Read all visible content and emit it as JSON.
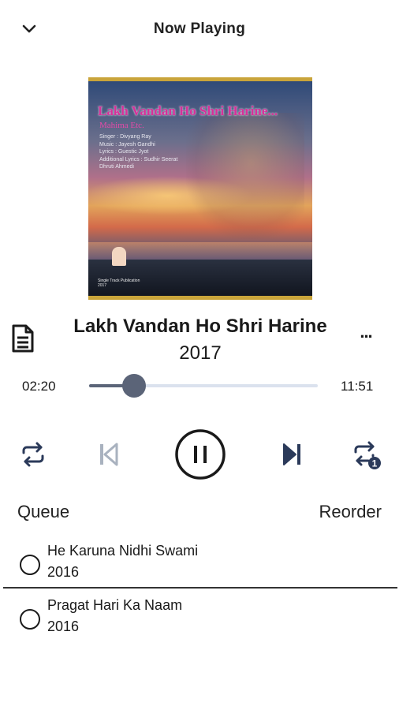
{
  "header": {
    "title": "Now Playing",
    "collapse_icon": "chevron-down-icon"
  },
  "artwork": {
    "title": "Lakh Vandan Ho Shri Harine...",
    "subtitle": "Mahima Etc.",
    "credits": [
      "Singer : Divyang Ray",
      "Music : Jayesh Gandhi",
      "Lyrics : Guestic Jyot",
      "Additional Lyrics : Sudhir Seerat",
      "Dhruti Ahmedi"
    ],
    "publisher": [
      "Single Track Publication",
      "2017"
    ],
    "frame_color": "#c9a43a"
  },
  "track": {
    "title": "Lakh Vandan Ho Shri Harine",
    "year": "2017",
    "more_label": "...",
    "lyrics_icon": "document-icon"
  },
  "progress": {
    "current": "02:20",
    "total": "11:51",
    "fraction": 0.197,
    "fill_color": "#5b6478",
    "track_color": "#dbe2ee"
  },
  "controls": {
    "repeat_icon": "repeat-icon",
    "previous_icon": "skip-previous-icon",
    "play_pause_icon": "pause-icon",
    "next_icon": "skip-next-icon",
    "repeat_one_icon": "repeat-one-icon",
    "repeat_one_badge": "1"
  },
  "queue": {
    "label": "Queue",
    "reorder_label": "Reorder",
    "items": [
      {
        "title": "He Karuna Nidhi Swami",
        "year": "2016"
      },
      {
        "title": "Pragat Hari Ka Naam",
        "year": "2016"
      }
    ]
  }
}
